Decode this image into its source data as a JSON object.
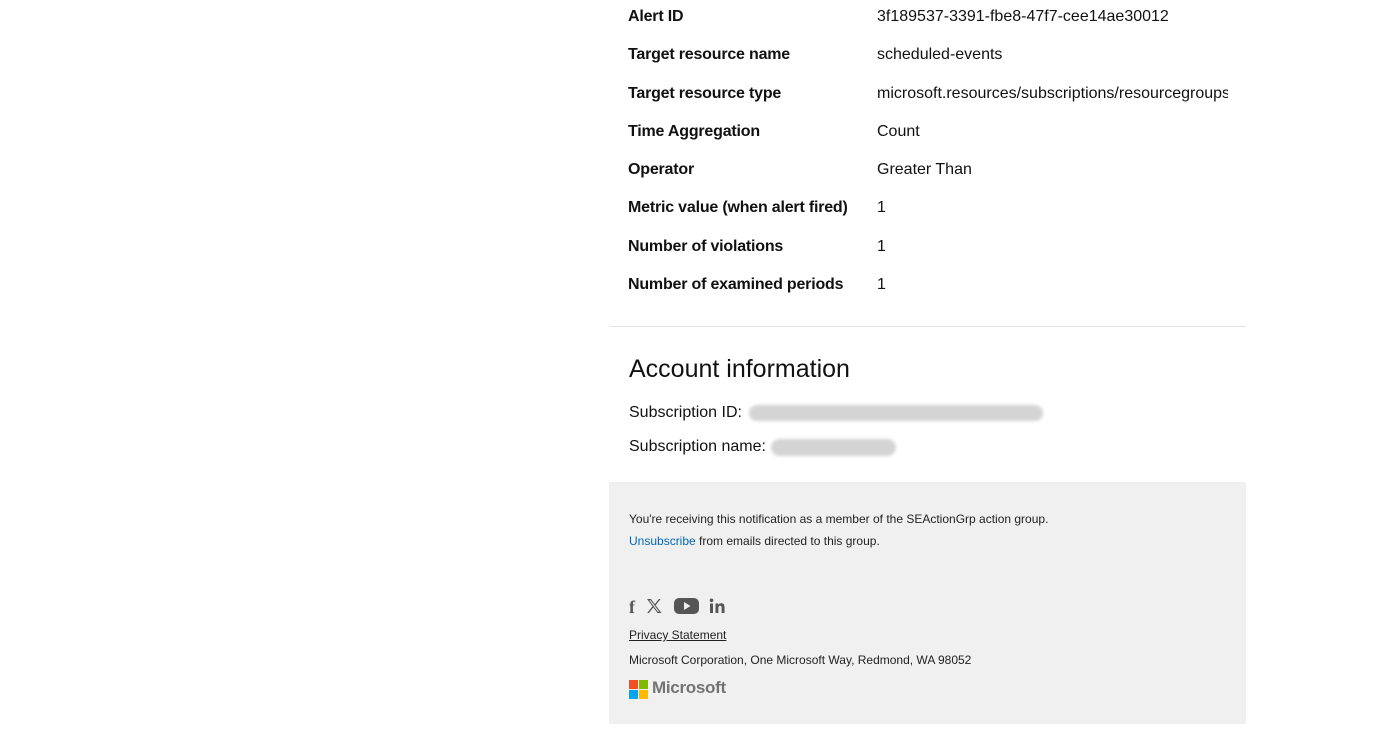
{
  "details": [
    {
      "key": "Alert ID",
      "value": "3f189537-3391-fbe8-47f7-cee14ae30012"
    },
    {
      "key": "Target resource name",
      "value": "scheduled-events"
    },
    {
      "key": "Target resource type",
      "value": "microsoft.resources/subscriptions/resourcegroups"
    },
    {
      "key": "Time Aggregation",
      "value": "Count"
    },
    {
      "key": "Operator",
      "value": "Greater Than"
    },
    {
      "key": "Metric value (when alert fired)",
      "value": "1"
    },
    {
      "key": "Number of violations",
      "value": "1"
    },
    {
      "key": "Number of examined periods",
      "value": "1"
    }
  ],
  "account": {
    "title": "Account information",
    "subscription_id_label": "Subscription ID:",
    "subscription_name_label": "Subscription name:"
  },
  "footer": {
    "notice": "You're receiving this notification as a member of the SEActionGrp action group.",
    "unsubscribe_link": "Unsubscribe",
    "unsubscribe_rest": " from emails directed to this group.",
    "social_icons": [
      "facebook-icon",
      "x-icon",
      "youtube-icon",
      "linkedin-icon"
    ],
    "privacy_link": "Privacy Statement",
    "address": "Microsoft Corporation, One Microsoft Way, Redmond, WA 98052",
    "brand": "Microsoft"
  },
  "colors": {
    "link": "#0067b8",
    "footer_bg": "#f0f0f0",
    "ms_red": "#f25022",
    "ms_green": "#7fba00",
    "ms_blue": "#00a4ef",
    "ms_yellow": "#ffb900"
  }
}
